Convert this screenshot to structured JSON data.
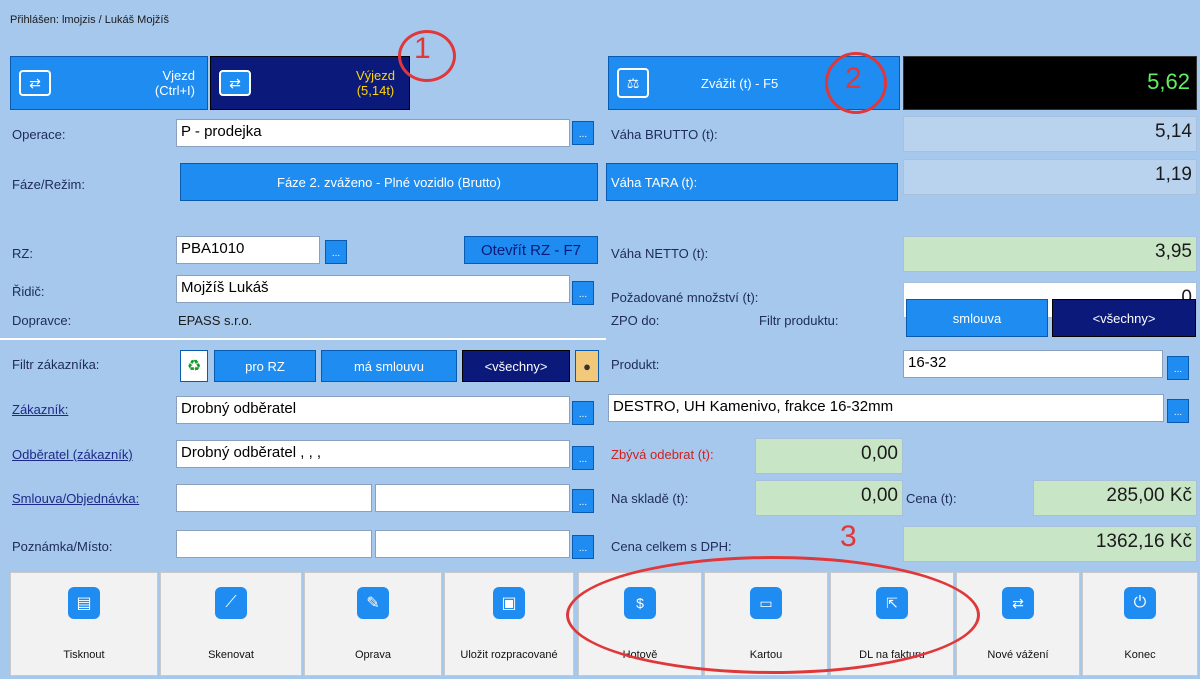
{
  "login": "Přihlášen: lmojzis / Lukáš Mojžíš",
  "entry_btn": {
    "line1": "Vjezd",
    "line2": "(Ctrl+I)"
  },
  "exit_btn": {
    "line1": "Výjezd",
    "line2": "(5,14t)"
  },
  "weigh_btn": "Zvážit (t) - F5",
  "display_value": "5,62",
  "form": {
    "operace_label": "Operace:",
    "operace_value": "P - prodejka",
    "faze_label": "Fáze/Režim:",
    "faze_value": "Fáze 2. zváženo - Plné vozidlo (Brutto)",
    "rz_label": "RZ:",
    "rz_value": "PBA1010",
    "otevrit_rz": "Otevřít RZ - F7",
    "ridic_label": "Řidič:",
    "ridic_value": "Mojžíš Lukáš",
    "dopravce_label": "Dopravce:",
    "dopravce_value": "EPASS s.r.o.",
    "filtr_label": "Filtr zákazníka:",
    "filtr_pro_rz": "pro RZ",
    "filtr_ma_smlouvu": "má smlouvu",
    "filtr_vsechny": "<všechny>",
    "zakaznik_label": "Zákazník:",
    "zakaznik_value": "Drobný odběratel",
    "odberatel_label": "Odběratel (zákazník)",
    "odberatel_value": "Drobný odběratel , , ,",
    "smlouva_label": "Smlouva/Objednávka:",
    "poznamka_label": "Poznámka/Místo:"
  },
  "weights": {
    "brutto_label": "Váha BRUTTO (t):",
    "brutto_value": "5,14",
    "tara_label": "Váha TARA (t):",
    "tara_value": "1,19",
    "netto_label": "Váha NETTO (t):",
    "netto_value": "3,95",
    "pozadovane_label": "Požadované množství (t):",
    "pozadovane_value": "0",
    "zpo_label": "ZPO do:",
    "filtr_produktu_label": "Filtr produktu:",
    "smlouva_btn": "smlouva",
    "vsechny_btn": "<všechny>",
    "produkt_label": "Produkt:",
    "produkt_value": "16-32",
    "produkt_desc": "DESTRO, UH Kamenivo, frakce 16-32mm",
    "zbyva_label": "Zbývá odebrat (t):",
    "zbyva_value": "0,00",
    "skladem_label": "Na skladě (t):",
    "skladem_value": "0,00",
    "cena_label": "Cena (t):",
    "cena_value": "285,00 Kč",
    "cena_celkem_label": "Cena celkem s DPH:",
    "cena_celkem_value": "1362,16 Kč"
  },
  "bottom": [
    {
      "label": "Tisknout",
      "icon": "printer-icon"
    },
    {
      "label": "Skenovat",
      "icon": "scanner-icon"
    },
    {
      "label": "Oprava",
      "icon": "edit-document-icon"
    },
    {
      "label": "Uložit rozpracované",
      "icon": "floppy-disk-icon"
    },
    {
      "label": "Hotově",
      "icon": "cash-icon"
    },
    {
      "label": "Kartou",
      "icon": "credit-card-icon"
    },
    {
      "label": "DL na fakturu",
      "icon": "invoice-export-icon"
    },
    {
      "label": "Nové vážení",
      "icon": "truck-scale-icon"
    },
    {
      "label": "Konec",
      "icon": "power-icon"
    }
  ],
  "annotations": {
    "one": "1",
    "two": "2",
    "three": "3"
  },
  "colors": {
    "accent": "#1e8cf0",
    "dark": "#0b1a7a",
    "background": "#a6c8ec",
    "highlight_green": "#c8e6c6",
    "annotation_red": "#e0383a"
  }
}
